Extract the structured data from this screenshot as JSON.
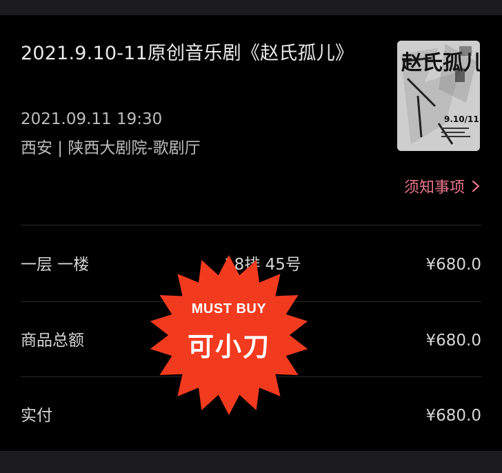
{
  "event": {
    "title": "2021.9.10-11原创音乐剧《赵氏孤儿》",
    "datetime": "2021.09.11 19:30",
    "venue": "西安 | 陕西大剧院-歌剧厅",
    "poster": {
      "title_chars": "赵氏孤儿",
      "date": "9.10/11"
    }
  },
  "notice": {
    "label": "须知事项"
  },
  "rows": {
    "seat": {
      "label": "一层 一楼",
      "seat": "18排 45号",
      "price": "¥680.0"
    },
    "subtotal": {
      "label": "商品总额",
      "value": "¥680.0"
    },
    "paid": {
      "label": "实付",
      "value": "¥680.0"
    }
  },
  "watermark": {
    "top": "MUST BUY",
    "main": "可小刀"
  },
  "colors": {
    "accent": "#e8758a",
    "badge": "#f23a1f"
  }
}
